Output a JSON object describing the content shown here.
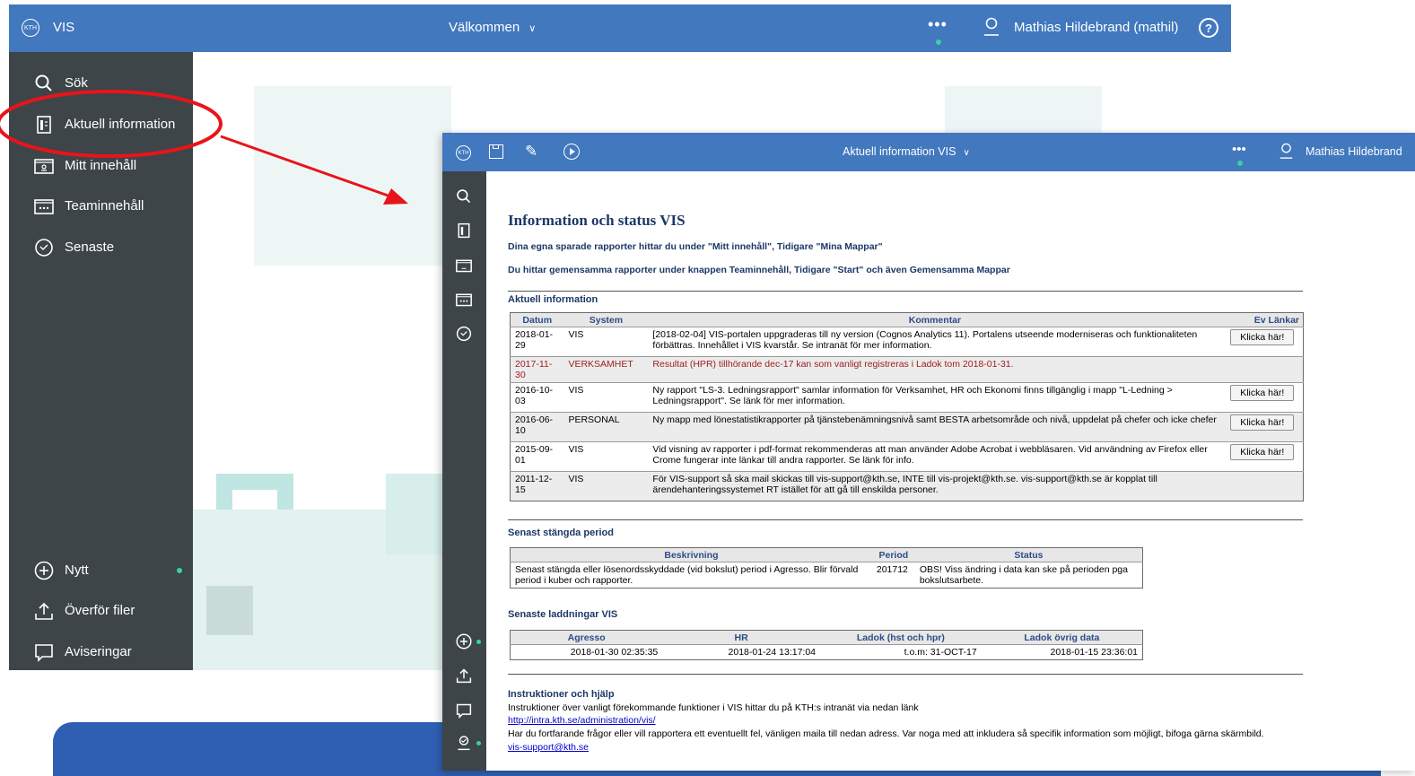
{
  "back_window": {
    "brand": "VIS",
    "welcome": "Välkommen",
    "user_name": "Mathias Hildebrand (mathil)",
    "sidebar": {
      "search": "Sök",
      "current_info": "Aktuell information",
      "my_content": "Mitt innehåll",
      "team_content": "Teaminnehåll",
      "recent": "Senaste",
      "new": "Nytt",
      "upload": "Överför filer",
      "notifications": "Aviseringar"
    }
  },
  "front_window": {
    "title": "Aktuell information VIS",
    "user_name": "Mathias Hildebrand",
    "report": {
      "heading": "Information och status VIS",
      "sub1": "Dina egna sparade rapporter hittar du under \"Mitt innehåll\", Tidigare \"Mina Mappar\"",
      "sub2": "Du hittar gemensamma rapporter under knappen Teaminnehåll, Tidigare \"Start\"  och även Gemensamma Mappar",
      "current_info": {
        "title": "Aktuell information",
        "headers": [
          "Datum",
          "System",
          "Kommentar",
          "Ev Länkar"
        ],
        "rows": [
          {
            "date": "2018-01-29",
            "system": "VIS",
            "comment": "[2018-02-04] VIS-portalen uppgraderas till ny version (Cognos Analytics 11). Portalens utseende moderniseras och funktionaliteten förbättras. Innehållet i VIS kvarstår. Se intranät för mer information.",
            "link": "Klicka här!"
          },
          {
            "date": "2017-11-30",
            "system": "VERKSAMHET",
            "comment": "Resultat (HPR) tillhörande dec-17 kan som vanligt registreras i Ladok tom 2018-01-31.",
            "link": ""
          },
          {
            "date": "2016-10-03",
            "system": "VIS",
            "comment": "Ny rapport \"LS-3. Ledningsrapport\" samlar information för Verksamhet, HR och Ekonomi finns tillgänglig i mapp \"L-Ledning > Ledningsrapport\". Se länk för mer information.",
            "link": "Klicka här!"
          },
          {
            "date": "2016-06-10",
            "system": "PERSONAL",
            "comment": "Ny mapp med lönestatistikrapporter på tjänstebenämningsnivå samt BESTA arbetsområde och nivå, uppdelat på chefer och icke chefer",
            "link": "Klicka här!"
          },
          {
            "date": "2015-09-01",
            "system": "VIS",
            "comment": "Vid visning av rapporter i pdf-format rekommenderas att man använder Adobe Acrobat i webbläsaren. Vid användning av Firefox eller Crome fungerar inte länkar till andra rapporter. Se länk för info.",
            "link": "Klicka här!"
          },
          {
            "date": "2011-12-15",
            "system": "VIS",
            "comment": "För VIS-support så ska mail skickas till vis-support@kth.se, INTE till vis-projekt@kth.se. vis-support@kth.se är kopplat till ärendehanteringssystemet RT istället för att gå till enskilda personer.",
            "link": ""
          }
        ]
      },
      "closed_period": {
        "title": "Senast stängda period",
        "headers": [
          "Beskrivning",
          "Period",
          "Status"
        ],
        "description": "Senast stängda eller lösenordsskyddade (vid bokslut) period i Agresso. Blir förvald period i kuber och rapporter.",
        "period": "201712",
        "status": "OBS! Viss ändring i data kan ske på perioden pga bokslutsarbete."
      },
      "latest_loads": {
        "title": "Senaste laddningar VIS",
        "headers": [
          "Agresso",
          "HR",
          "Ladok (hst och hpr)",
          "Ladok övrig data"
        ],
        "values": [
          "2018-01-30 02:35:35",
          "2018-01-24 13:17:04",
          "t.o.m: 31-OCT-17",
          "2018-01-15 23:36:01"
        ]
      },
      "help": {
        "title": "Instruktioner och hjälp",
        "line1": "Instruktioner över vanligt förekommande funktioner i VIS hittar du på KTH:s intranät via nedan länk",
        "link1": "http://intra.kth.se/administration/vis/",
        "line2": "Har du fortfarande frågor eller vill rapportera ett eventuellt fel, vänligen maila till nedan adress. Var noga med att inkludera så specifik information som möjligt, bifoga gärna skärmbild.",
        "link2": "vis-support@kth.se"
      }
    }
  },
  "colors": {
    "topbar": "#4178be",
    "sidebar": "#3d4549",
    "accent_green": "#3ad29f",
    "annotation_red": "#e8141a",
    "heading_navy": "#1c3866",
    "banner": "#2f5fb3"
  }
}
